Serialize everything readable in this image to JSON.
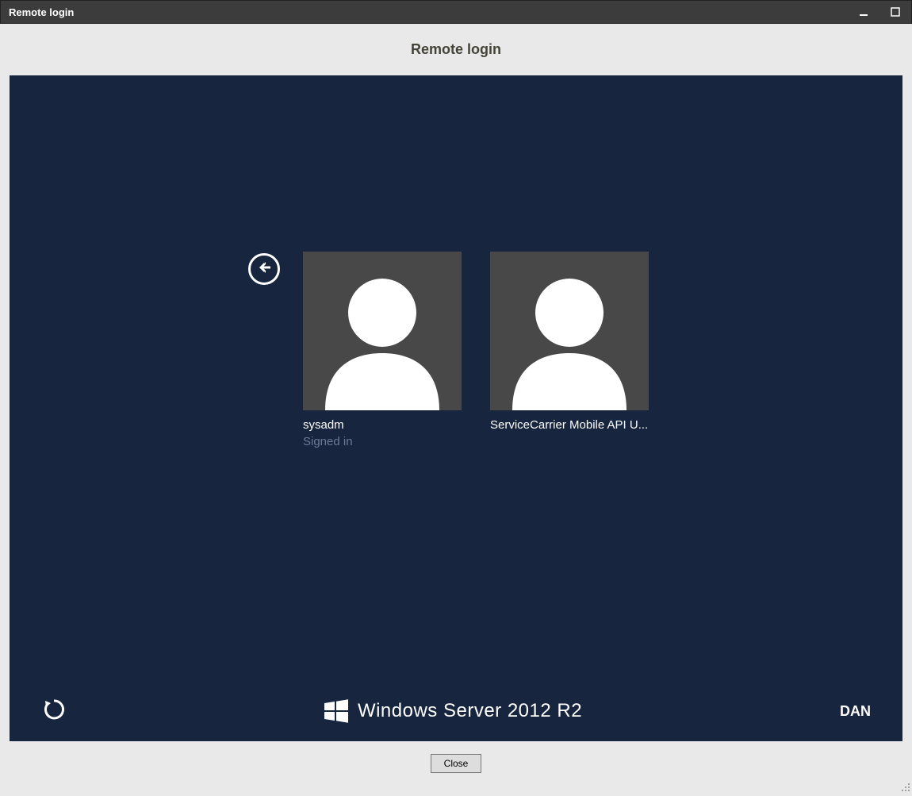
{
  "window": {
    "title": "Remote login"
  },
  "header": {
    "subtitle": "Remote login"
  },
  "login": {
    "users": [
      {
        "name": "sysadm",
        "status": "Signed in"
      },
      {
        "name": "ServiceCarrier Mobile API U...",
        "status": ""
      }
    ]
  },
  "branding": {
    "text_prefix": "Windows Server",
    "text_year": "2012",
    "text_suffix": "R2"
  },
  "language": {
    "code": "DAN"
  },
  "buttons": {
    "close": "Close"
  }
}
